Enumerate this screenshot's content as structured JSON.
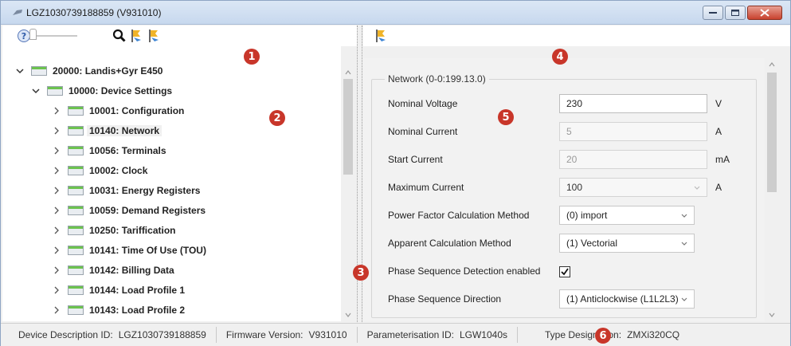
{
  "window": {
    "title": "LGZ1030739188859 (V931010)"
  },
  "left_toolbar": {
    "icons": [
      "help-icon",
      "zoom-slider",
      "search-icon",
      "bookmark-icon",
      "bookmark-icon"
    ]
  },
  "tree": {
    "items": [
      {
        "label": "20000: Landis+Gyr E450",
        "expanded": true
      },
      {
        "label": "10000: Device Settings",
        "expanded": true
      },
      {
        "label": "10001: Configuration"
      },
      {
        "label": "10140: Network",
        "selected": true
      },
      {
        "label": "10056: Terminals"
      },
      {
        "label": "10002: Clock"
      },
      {
        "label": "10031: Energy Registers"
      },
      {
        "label": "10059: Demand Registers"
      },
      {
        "label": "10250: Tariffication"
      },
      {
        "label": "10141: Time Of Use (TOU)"
      },
      {
        "label": "10142: Billing Data"
      },
      {
        "label": "10144: Load Profile 1"
      },
      {
        "label": "10143: Load Profile 2"
      }
    ]
  },
  "network_group": {
    "title": "Network (0-0:199.13.0)",
    "fields": [
      {
        "label": "Nominal Voltage",
        "value": "230",
        "unit": "V"
      },
      {
        "label": "Nominal Current",
        "value": "5",
        "unit": "A"
      },
      {
        "label": "Start Current",
        "value": "20",
        "unit": "mA"
      },
      {
        "label": "Maximum Current",
        "value": "100",
        "unit": "A"
      },
      {
        "label": "Power Factor Calculation Method",
        "value": "(0) import"
      },
      {
        "label": "Apparent Calculation Method",
        "value": "(1) Vectorial"
      },
      {
        "label": "Phase Sequence Detection enabled",
        "checked": true
      },
      {
        "label": "Phase Sequence Direction",
        "value": "(1) Anticlockwise (L1L2L3)"
      }
    ]
  },
  "status": {
    "device_description_label": "Device Description ID:",
    "device_description_value": "LGZ1030739188859",
    "firmware_label": "Firmware Version:",
    "firmware_value": "V931010",
    "param_label": "Parameterisation ID:",
    "param_value": "LGW1040s",
    "type_label": "Type Designation:",
    "type_value": "ZMXi320CQ"
  },
  "callouts": [
    "1",
    "2",
    "3",
    "4",
    "5",
    "6"
  ],
  "colors": {
    "callout": "#c8362a",
    "node_green": "#6cc34f",
    "close_button": "#c8422e"
  }
}
